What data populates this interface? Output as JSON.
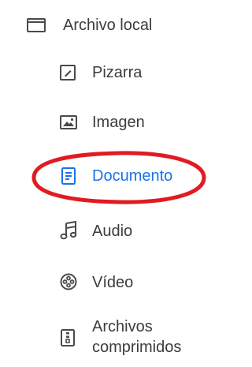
{
  "menu": {
    "header": {
      "label": "Archivo local",
      "icon": "folder-icon"
    },
    "items": [
      {
        "label": "Pizarra",
        "icon": "whiteboard-icon"
      },
      {
        "label": "Imagen",
        "icon": "image-icon"
      },
      {
        "label": "Documento",
        "icon": "document-icon",
        "selected": true
      },
      {
        "label": "Audio",
        "icon": "music-note-icon"
      },
      {
        "label": "Vídeo",
        "icon": "video-reel-icon"
      },
      {
        "label": "Archivos comprimidos",
        "label_line1": "Archivos",
        "label_line2": "comprimidos",
        "icon": "archive-icon"
      }
    ]
  },
  "colors": {
    "text": "#3c3c3c",
    "icon": "#4a4a4a",
    "selected": "#1a73e8",
    "highlight": "#e11b22"
  }
}
